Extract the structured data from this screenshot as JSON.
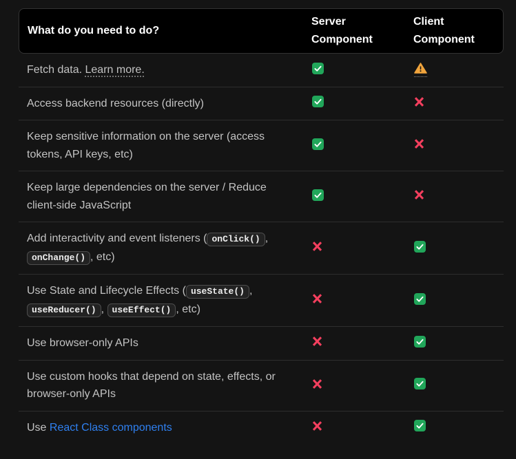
{
  "header": {
    "question_label": "What do you need to do?",
    "server_label": "Server Component",
    "client_label": "Client Component"
  },
  "colors": {
    "check_green": "#21a65a",
    "cross_rose": "#f43f5e",
    "warning_orange": "#f0a43c",
    "link_blue": "#2f80f0",
    "header_bg": "#000000",
    "page_bg": "#141414"
  },
  "rows": [
    {
      "question": [
        {
          "t": "text",
          "v": "Fetch data. "
        },
        {
          "t": "dotted",
          "v": "Learn more."
        }
      ],
      "server": "check",
      "client": "warning"
    },
    {
      "question": [
        {
          "t": "text",
          "v": "Access backend resources (directly)"
        }
      ],
      "server": "check",
      "client": "cross"
    },
    {
      "question": [
        {
          "t": "text",
          "v": "Keep sensitive information on the server (access tokens, API keys, etc)"
        }
      ],
      "server": "check",
      "client": "cross"
    },
    {
      "question": [
        {
          "t": "text",
          "v": "Keep large dependencies on the server / Reduce client-side JavaScript"
        }
      ],
      "server": "check",
      "client": "cross"
    },
    {
      "question": [
        {
          "t": "text",
          "v": "Add interactivity and event listeners ("
        },
        {
          "t": "code",
          "v": "onClick()"
        },
        {
          "t": "text",
          "v": ", "
        },
        {
          "t": "code",
          "v": "onChange()"
        },
        {
          "t": "text",
          "v": ", etc)"
        }
      ],
      "server": "cross",
      "client": "check"
    },
    {
      "question": [
        {
          "t": "text",
          "v": "Use State and Lifecycle Effects ("
        },
        {
          "t": "code",
          "v": "useState()"
        },
        {
          "t": "text",
          "v": ", "
        },
        {
          "t": "code",
          "v": "useReducer()"
        },
        {
          "t": "text",
          "v": ", "
        },
        {
          "t": "code",
          "v": "useEffect()"
        },
        {
          "t": "text",
          "v": ", etc)"
        }
      ],
      "server": "cross",
      "client": "check"
    },
    {
      "question": [
        {
          "t": "text",
          "v": "Use browser-only APIs"
        }
      ],
      "server": "cross",
      "client": "check"
    },
    {
      "question": [
        {
          "t": "text",
          "v": "Use custom hooks that depend on state, effects, or browser-only APIs"
        }
      ],
      "server": "cross",
      "client": "check"
    },
    {
      "question": [
        {
          "t": "text",
          "v": "Use "
        },
        {
          "t": "link",
          "v": "React Class components"
        }
      ],
      "server": "cross",
      "client": "check"
    }
  ]
}
